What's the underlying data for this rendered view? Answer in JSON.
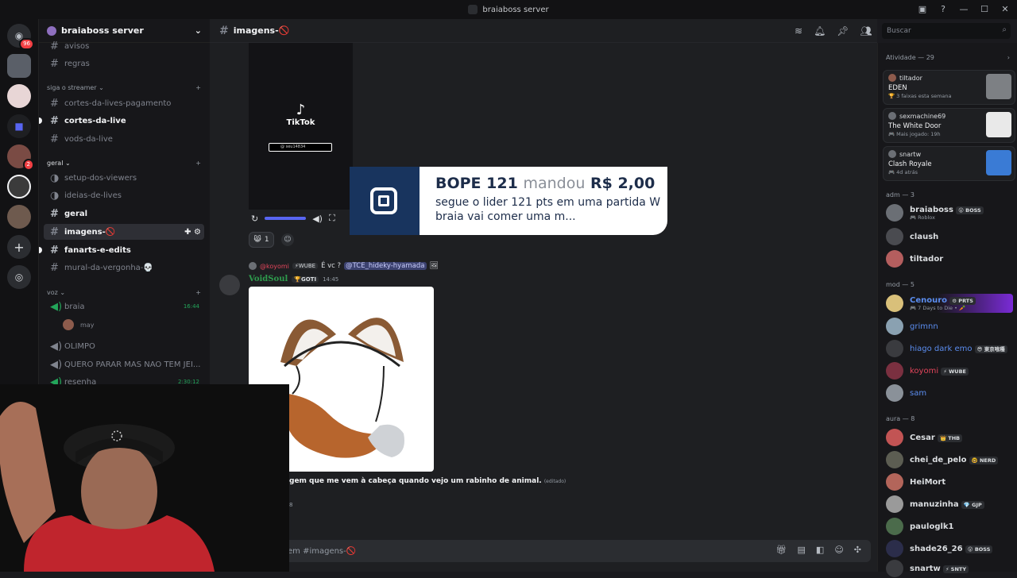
{
  "window": {
    "title": "braiaboss server"
  },
  "server": {
    "name": "braiaboss server"
  },
  "guild_badges": {
    "first": "96",
    "second": "2"
  },
  "sidebar": {
    "channels_top": [
      {
        "label": "avisos"
      },
      {
        "label": "regras"
      }
    ],
    "cat_streamer": "siga o streamer",
    "streamer_channels": [
      {
        "label": "cortes-da-lives-pagamento"
      },
      {
        "label": "cortes-da-live"
      },
      {
        "label": "vods-da-live"
      }
    ],
    "cat_geral": "geral",
    "geral_channels": [
      {
        "label": "setup-dos-viewers"
      },
      {
        "label": "ideias-de-lives"
      },
      {
        "label": "geral"
      },
      {
        "label": "imagens-🚫"
      },
      {
        "label": "fanarts-e-edits"
      },
      {
        "label": "mural-da-vergonha-💀"
      }
    ],
    "cat_voz": "voz",
    "voice": [
      {
        "label": "braia",
        "time": "16:44"
      },
      {
        "label": "may"
      },
      {
        "label": "OLIMPO"
      },
      {
        "label": "QUERO PARAR MAS NAO TEM JEI..."
      },
      {
        "label": "resenha",
        "time": "2:30:12"
      }
    ]
  },
  "channel": {
    "name": "imagens-🚫"
  },
  "search": {
    "placeholder": "Buscar"
  },
  "video": {
    "brand": "TikTok",
    "handle": "@ seu14834"
  },
  "donation": {
    "sender": "BOPE 121",
    "verb": "mandou",
    "amount": "R$ 2,00",
    "message": "segue o lider 121 pts em uma partida W braia vai comer uma m..."
  },
  "reaction": {
    "count": "1"
  },
  "message": {
    "reply_user": "@koyomi",
    "reply_tag": "⚡WUBE",
    "reply_text": "É vc ?",
    "reply_mention": "@TCE_hideky-hyamada",
    "author": "VoidSoul",
    "author_tag": "🏆GOTI",
    "time": "14:45",
    "text": "gem que me vem à cabeça quando vejo um rabinho de animal.",
    "edited": "(editado)",
    "extra": "8"
  },
  "composer": {
    "placeholder": "em #imagens-🚫"
  },
  "members": {
    "activity_header": "Atividade — 29",
    "activities": [
      {
        "user": "tiltador",
        "game": "EDEN",
        "sub": "🏆 3 faixas esta semana"
      },
      {
        "user": "sexmachine69",
        "game": "The White Door",
        "sub": "🎮 Mais jogado: 19h"
      },
      {
        "user": "snartw",
        "game": "Clash Royale",
        "sub": "🎮 4d atrás"
      }
    ],
    "adm_header": "adm — 3",
    "adm": [
      {
        "name": "braiaboss",
        "tag": "😮 BOSS",
        "sub": "🎮 Roblox",
        "color": "#f2f3f5"
      },
      {
        "name": "claush",
        "color": "#f2f3f5"
      },
      {
        "name": "tiltador",
        "color": "#f2f3f5"
      }
    ],
    "mod_header": "mod — 5",
    "mod": [
      {
        "name": "Cenouro",
        "tag": "⚙ PRTS",
        "sub": "🎮 7 Days to Die • 🥕",
        "color": "#5b8def"
      },
      {
        "name": "grimnn",
        "color": "#5b8def"
      },
      {
        "name": "hiago dark emo",
        "tag": "😎 東京喰種",
        "color": "#5b8def"
      },
      {
        "name": "koyomi",
        "tag": "⚡ WUBE",
        "color": "#e3455b"
      },
      {
        "name": "sam",
        "color": "#5b8def"
      }
    ],
    "aura_header": "aura — 8",
    "aura": [
      {
        "name": "Cesar",
        "tag": "👑 THB",
        "color": "#f2f3f5"
      },
      {
        "name": "chei_de_pelo",
        "tag": "🤓 NERD",
        "color": "#f2f3f5"
      },
      {
        "name": "HeiMort",
        "color": "#f2f3f5"
      },
      {
        "name": "manuzinha",
        "tag": "💎 GJP",
        "color": "#f2f3f5"
      },
      {
        "name": "pauloglk1",
        "color": "#f2f3f5"
      },
      {
        "name": "shade26_26",
        "tag": "😮 BOSS",
        "color": "#f2f3f5"
      },
      {
        "name": "snartw",
        "tag": "⚡ SNTY",
        "color": "#f2f3f5"
      }
    ]
  },
  "colors": {
    "accent": "#5865f2",
    "donation_bg": "#18345e",
    "online": "#23a55a",
    "dnd": "#f23f43"
  }
}
